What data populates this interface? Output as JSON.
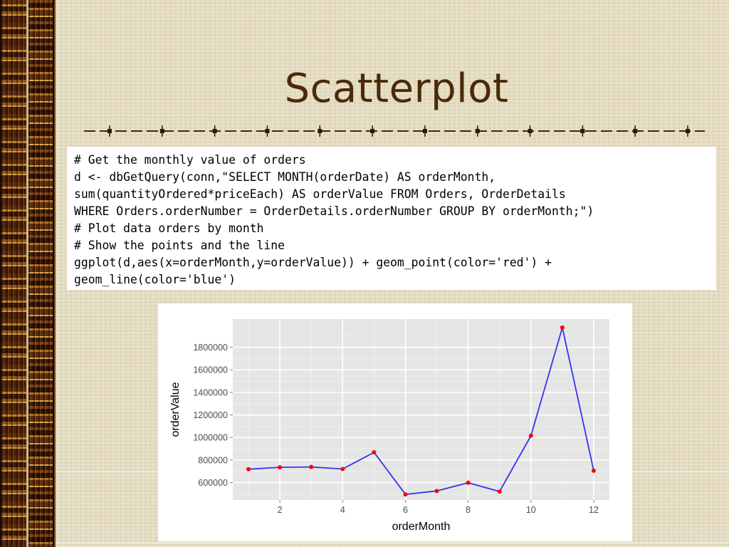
{
  "slide": {
    "title": "Scatterplot"
  },
  "code": {
    "lines": [
      "# Get the monthly value of orders",
      "d <- dbGetQuery(conn,\"SELECT MONTH(orderDate) AS orderMonth,",
      "sum(quantityOrdered*priceEach) AS orderValue FROM Orders, OrderDetails",
      "WHERE Orders.orderNumber = OrderDetails.orderNumber GROUP BY orderMonth;\")",
      "# Plot data orders by month",
      "# Show the points and the line",
      "ggplot(d,aes(x=orderMonth,y=orderValue)) + geom_point(color='red') +",
      "geom_line(color='blue')"
    ]
  },
  "colors": {
    "title": "#4a2a08",
    "panel_bg": "#e5e5e5",
    "line": "#3434f0",
    "point": "#ff0000"
  },
  "chart_data": {
    "type": "line",
    "title": "",
    "xlabel": "orderMonth",
    "ylabel": "orderValue",
    "x": [
      1,
      2,
      3,
      4,
      5,
      6,
      7,
      8,
      9,
      10,
      11,
      12
    ],
    "series": [
      {
        "values": [
          718000,
          735000,
          738000,
          720000,
          868000,
          495000,
          525000,
          598000,
          520000,
          1015000,
          1975000,
          705000
        ]
      }
    ],
    "xticks": [
      2,
      4,
      6,
      8,
      10,
      12
    ],
    "yticks": [
      600000,
      800000,
      1000000,
      1200000,
      1400000,
      1600000,
      1800000
    ],
    "xlim": [
      0.5,
      12.5
    ],
    "ylim": [
      445000,
      2050000
    ],
    "grid": true,
    "legend": "none"
  }
}
